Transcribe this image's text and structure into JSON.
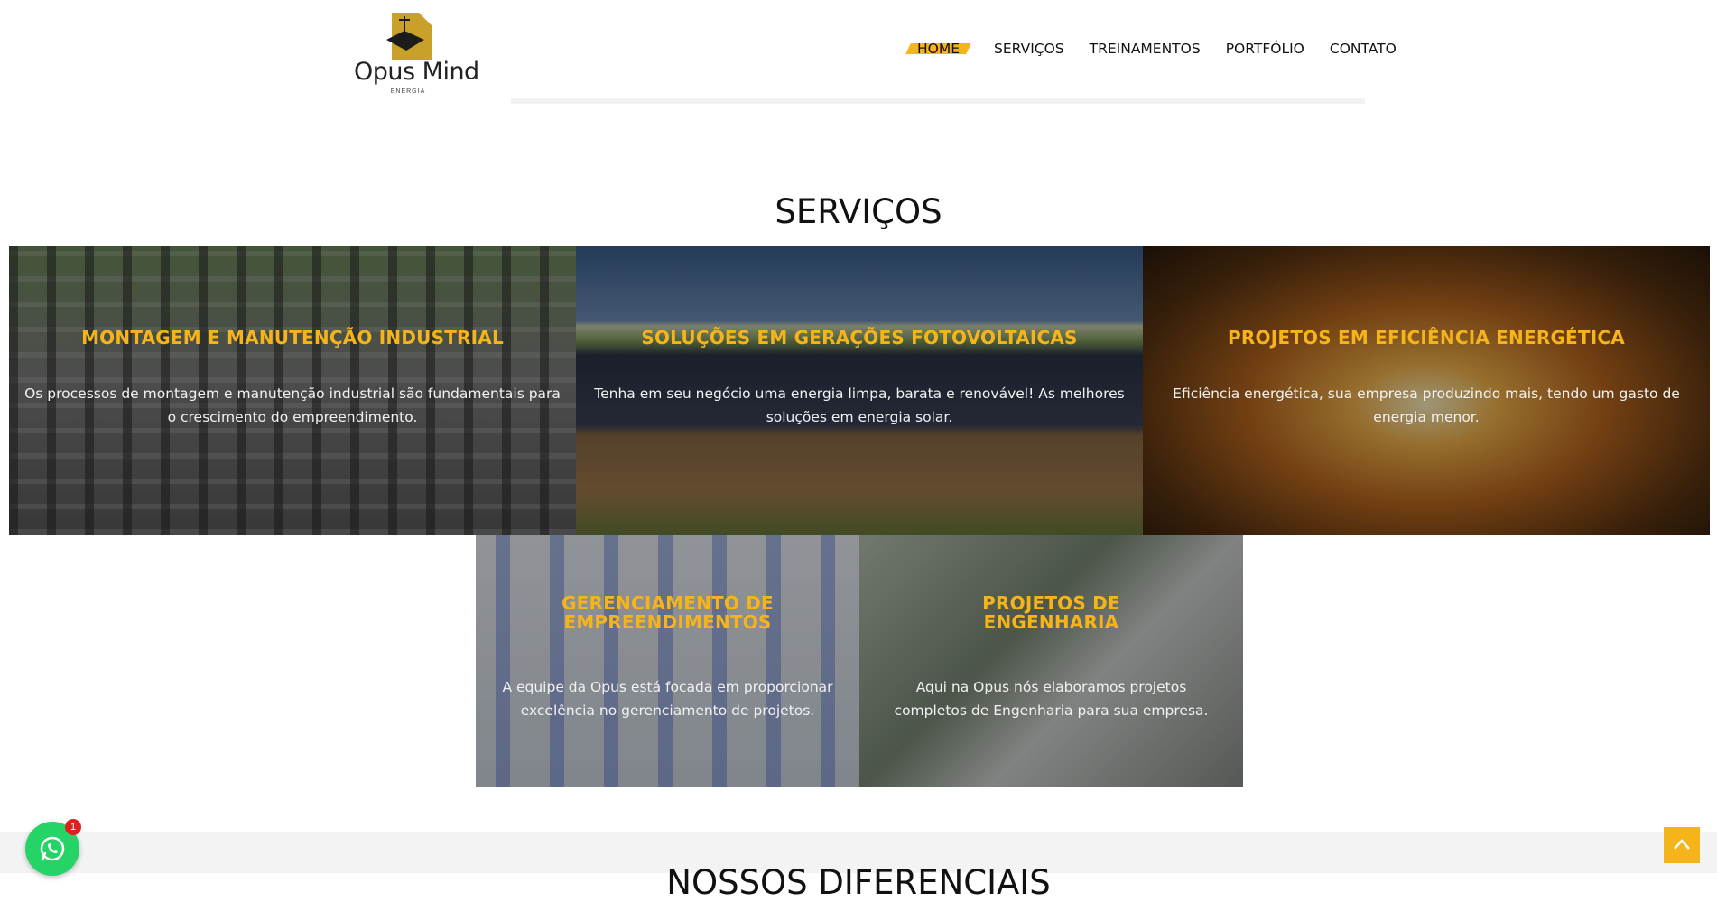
{
  "brand": {
    "name": "Opus Mind",
    "tagline": "ENERGIA",
    "accent_color": "#f4b41a"
  },
  "nav": {
    "items": [
      {
        "label": "HOME",
        "active": true
      },
      {
        "label": "SERVIÇOS"
      },
      {
        "label": "TREINAMENTOS"
      },
      {
        "label": "PORTFÓLIO"
      },
      {
        "label": "CONTATO"
      }
    ]
  },
  "services": {
    "title": "SERVIÇOS",
    "cards": [
      {
        "title": "MONTAGEM E MANUTENÇÃO INDUSTRIAL",
        "text": "Os processos de montagem e manutenção industrial são fundamentais para o crescimento do empreendimento."
      },
      {
        "title": "SOLUÇÕES EM GERAÇÕES FOTOVOLTAICAS",
        "text": "Tenha em seu negócio uma energia limpa, barata e renovável! As melhores soluções em energia solar."
      },
      {
        "title": "PROJETOS EM EFICIÊNCIA ENERGÉTICA",
        "text": "Eficiência energética, sua empresa produzindo mais, tendo um gasto de energia menor."
      },
      {
        "title": "GERENCIAMENTO DE EMPREENDIMENTOS",
        "text": "A equipe da Opus está focada em proporcionar excelência no gerenciamento de projetos."
      },
      {
        "title": "PROJETOS DE ENGENHARIA",
        "text": "Aqui na Opus nós elaboramos projetos completos de Engenharia para sua empresa."
      }
    ]
  },
  "differentials": {
    "title": "NOSSOS DIFERENCIAIS"
  },
  "widgets": {
    "whatsapp_icon": "whatsapp-icon",
    "whatsapp_badge": "1",
    "scroll_top_icon": "chevron-up-icon"
  }
}
